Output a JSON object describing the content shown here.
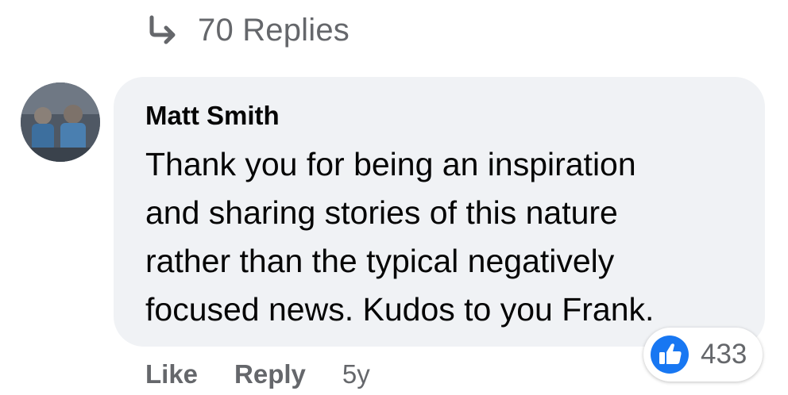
{
  "replies": {
    "count_label": "70 Replies",
    "icon": "reply-arrow-icon"
  },
  "comment": {
    "author": "Matt Smith",
    "avatar_icon": "avatar",
    "lines": [
      "Thank you for being an inspiration",
      "and sharing stories of this nature",
      "rather than the typical negatively",
      "focused news. Kudos to you Frank."
    ],
    "bubble_color": "#f0f2f5"
  },
  "reactions": {
    "icon": "like-reaction-icon",
    "count": "433",
    "like_color": "#1877f2"
  },
  "actions": {
    "like_label": "Like",
    "reply_label": "Reply",
    "timestamp": "5y"
  },
  "colors": {
    "secondary_text": "#65676b",
    "primary_text": "#050505"
  }
}
